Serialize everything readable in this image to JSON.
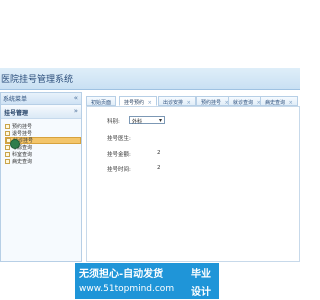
{
  "app": {
    "title": "医院挂号管理系统"
  },
  "left_panel": {
    "header_label": "系统菜单",
    "collapse_icon": "«",
    "group_label": "挂号管理",
    "group_chevron": "»",
    "items": [
      "预约挂号",
      "退号挂号",
      "就诊挂号",
      "号源查询",
      "科室查询",
      "病史查询"
    ]
  },
  "tabs": [
    "初始页面",
    "挂号预约",
    "出诊安排",
    "预约挂号",
    "就诊查询",
    "病史查询"
  ],
  "form": {
    "field1_label": "科别:",
    "field1_value": "外科",
    "field2_label": "挂号医生:",
    "field3_label": "挂号金额:",
    "field3_value": "2",
    "field4_label": "挂号时间:",
    "field4_value": "2"
  },
  "watermark": {
    "line1": "无须担心-自动发货",
    "line2": "www.51topmind.com",
    "badge_line1": "毕业",
    "badge_line2": "设计"
  },
  "colors": {
    "header_bg": "#cfe2f4",
    "selection_bg": "#f3c56b",
    "watermark_bg": "#1f95d8"
  },
  "icons": {
    "collapse": "double-left-arrow",
    "doc": "document-icon",
    "select_arrow": "chevron-down-icon",
    "close": "close-icon"
  }
}
